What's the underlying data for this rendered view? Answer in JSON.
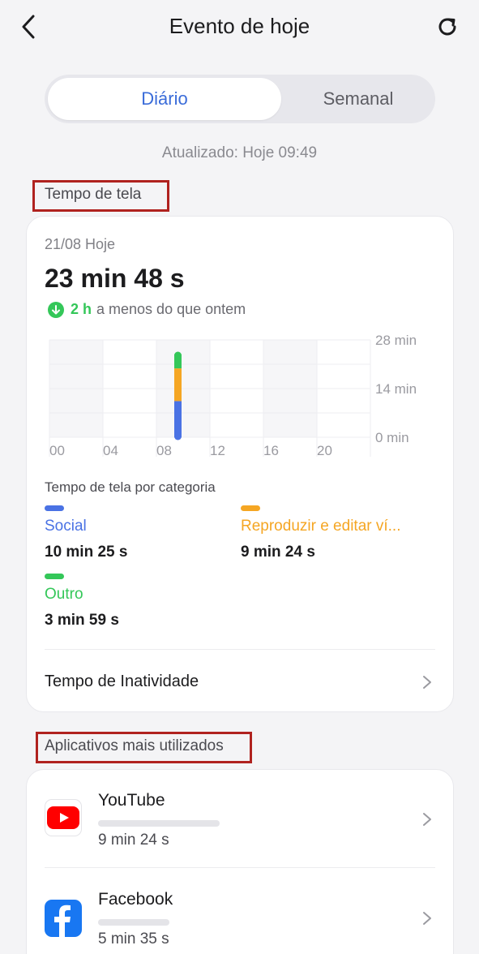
{
  "header": {
    "title": "Evento de hoje"
  },
  "tabs": [
    {
      "label": "Diário",
      "active": true
    },
    {
      "label": "Semanal",
      "active": false
    }
  ],
  "updated": "Atualizado: Hoje 09:49",
  "screen_time": {
    "section_label": "Tempo de tela",
    "date": "21/08 Hoje",
    "total": "23 min 48 s",
    "compare_value": "2 h",
    "compare_text": "a menos do que ontem",
    "chart_data": {
      "type": "bar",
      "x_ticks": [
        "00",
        "04",
        "08",
        "12",
        "16",
        "20"
      ],
      "y_ticks": [
        "28 min",
        "14 min",
        "0 min"
      ],
      "ylim": [
        0,
        28
      ],
      "bars": [
        {
          "hour": 9,
          "segments": [
            {
              "series": "Social",
              "value": 10.4
            },
            {
              "series": "Reproduzir e editar ví...",
              "value": 9.4
            },
            {
              "series": "Outro",
              "value": 4.0
            }
          ]
        }
      ]
    },
    "category_title": "Tempo de tela por categoria",
    "categories": [
      {
        "name": "Social",
        "value": "10 min 25 s",
        "color": "#4a72e4"
      },
      {
        "name": "Reproduzir e editar ví...",
        "value": "9 min 24 s",
        "color": "#f5a623"
      },
      {
        "name": "Outro",
        "value": "3 min 59 s",
        "color": "#34c759"
      }
    ],
    "idle_label": "Tempo de Inatividade"
  },
  "apps": {
    "section_label": "Aplicativos mais utilizados",
    "items": [
      {
        "name": "YouTube",
        "time": "9 min 24 s",
        "icon": "youtube-icon",
        "usage": 0.4
      },
      {
        "name": "Facebook",
        "time": "5 min 35 s",
        "icon": "facebook-icon",
        "usage": 0.24
      }
    ]
  }
}
